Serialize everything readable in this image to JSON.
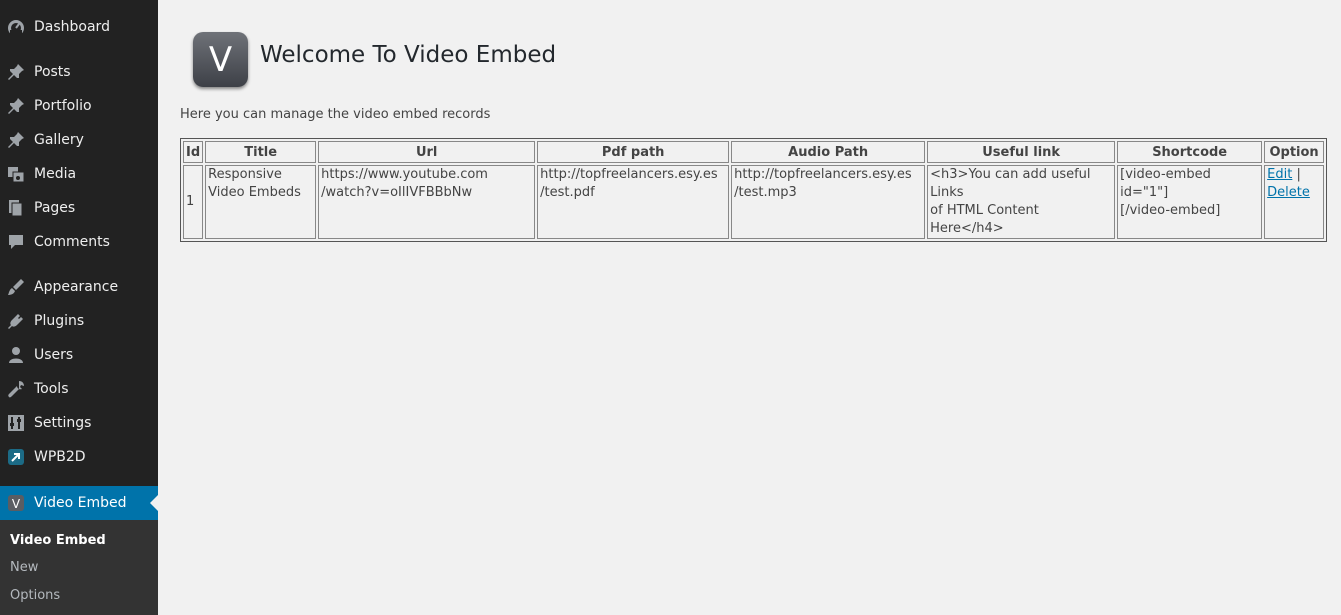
{
  "sidebar": {
    "items": [
      {
        "label": "Dashboard",
        "icon": "dashboard-icon"
      },
      {
        "label": "Posts",
        "icon": "pin-icon"
      },
      {
        "label": "Portfolio",
        "icon": "pin-icon"
      },
      {
        "label": "Gallery",
        "icon": "pin-icon"
      },
      {
        "label": "Media",
        "icon": "media-icon"
      },
      {
        "label": "Pages",
        "icon": "pages-icon"
      },
      {
        "label": "Comments",
        "icon": "comment-icon"
      },
      {
        "label": "Appearance",
        "icon": "paintbrush-icon"
      },
      {
        "label": "Plugins",
        "icon": "plug-icon"
      },
      {
        "label": "Users",
        "icon": "user-icon"
      },
      {
        "label": "Tools",
        "icon": "wrench-icon"
      },
      {
        "label": "Settings",
        "icon": "settings-icon"
      },
      {
        "label": "WPB2D",
        "icon": "wpb2d-icon"
      },
      {
        "label": "Video Embed",
        "icon": "video-embed-icon",
        "active": true
      }
    ],
    "submenu": [
      {
        "label": "Video Embed",
        "current": true
      },
      {
        "label": "New"
      },
      {
        "label": "Options"
      }
    ]
  },
  "header": {
    "logo_letter": "V",
    "title": "Welcome To Video Embed",
    "description": "Here you can manage the video embed records"
  },
  "table": {
    "headers": [
      "Id",
      "Title",
      "Url",
      "Pdf path",
      "Audio Path",
      "Useful link",
      "Shortcode",
      "Option"
    ],
    "rows": [
      {
        "id": "1",
        "title_line1": "Responsive",
        "title_line2": "Video Embeds",
        "url_line1": "https://www.youtube.com",
        "url_line2": "/watch?v=oIlIVFBBbNw",
        "pdf_line1": "http://topfreelancers.esy.es",
        "pdf_line2": "/test.pdf",
        "audio_line1": "http://topfreelancers.esy.es",
        "audio_line2": "/test.mp3",
        "link_line1": "<h3>You can add useful Links",
        "link_line2": "of HTML Content Here</h4>",
        "shortcode_line1": "[video-embed id=\"1\"]",
        "shortcode_line2": "[/video-embed]",
        "edit": "Edit",
        "separator": "|",
        "delete": "Delete"
      }
    ]
  },
  "colors": {
    "sidebar_bg": "#222222",
    "submenu_bg": "#333333",
    "active_bg": "#0073aa",
    "content_bg": "#f1f1f1",
    "link": "#0073aa"
  }
}
